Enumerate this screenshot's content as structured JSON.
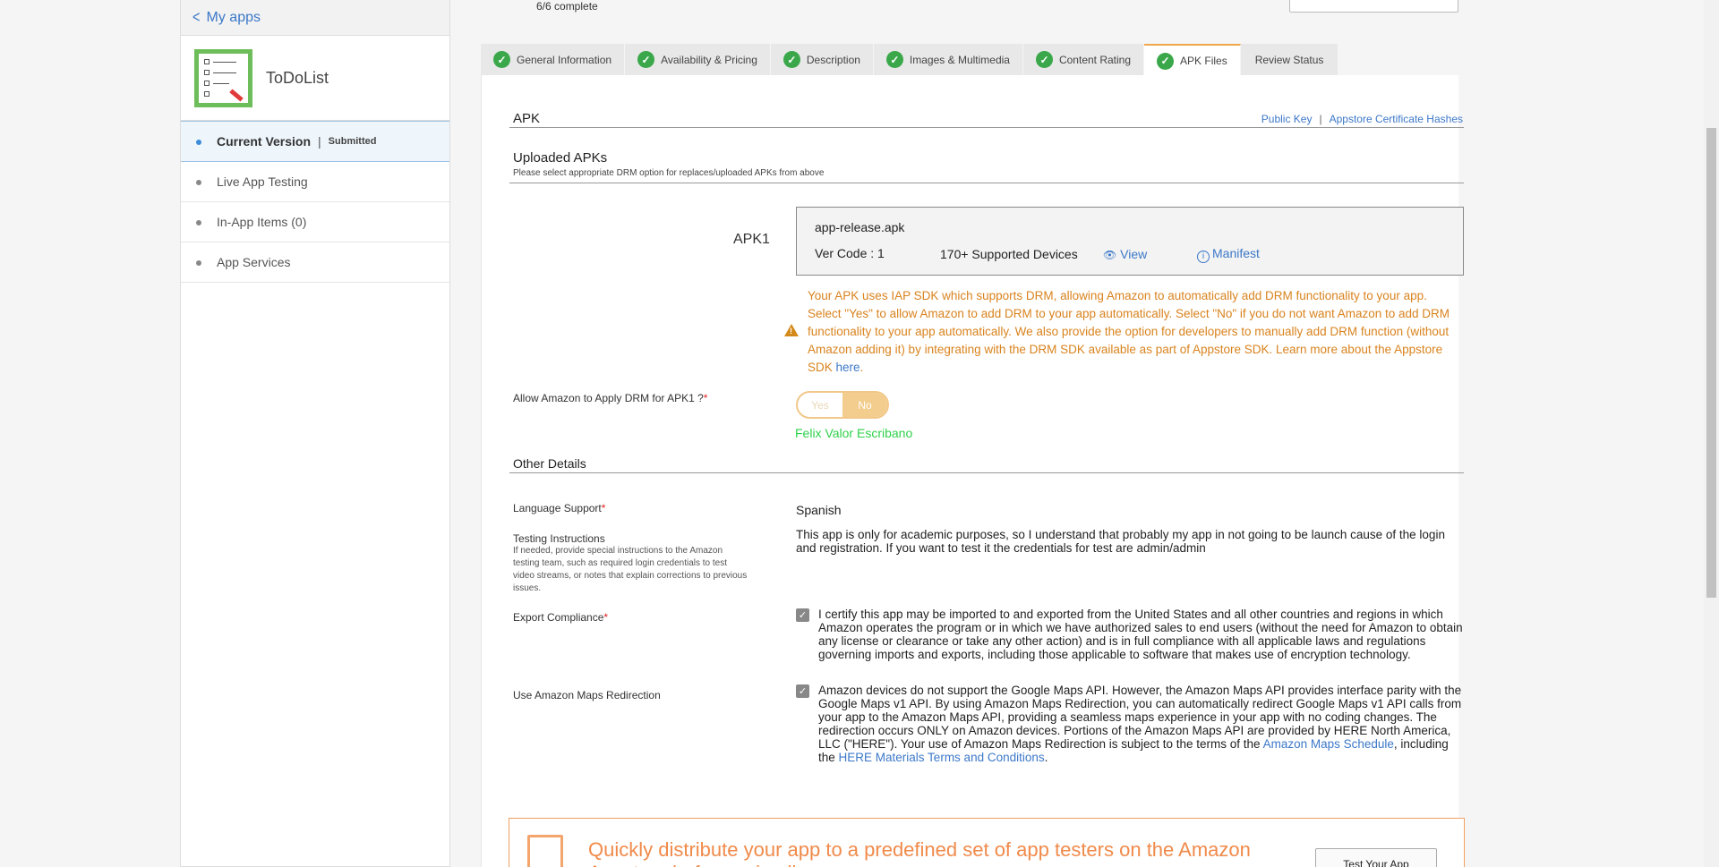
{
  "sidebar": {
    "back_label": "My apps",
    "app_name": "ToDoList",
    "items": [
      {
        "label": "Current Version",
        "status": "Submitted"
      },
      {
        "label": "Live App Testing"
      },
      {
        "label": "In-App Items (0)"
      },
      {
        "label": "App Services"
      }
    ]
  },
  "header": {
    "progress": "6/6 complete"
  },
  "tabs": [
    {
      "label": "General Information",
      "complete": true
    },
    {
      "label": "Availability & Pricing",
      "complete": true
    },
    {
      "label": "Description",
      "complete": true
    },
    {
      "label": "Images & Multimedia",
      "complete": true
    },
    {
      "label": "Content Rating",
      "complete": true
    },
    {
      "label": "APK Files",
      "complete": true,
      "active": true
    },
    {
      "label": "Review Status",
      "complete": false
    }
  ],
  "apk_section": {
    "title": "APK",
    "public_key_link": "Public Key",
    "link_separator": "|",
    "cert_hashes_link": "Appstore Certificate Hashes",
    "uploaded_title": "Uploaded APKs",
    "uploaded_note": "Please select appropriate DRM option for replaces/uploaded APKs from above",
    "apk_label": "APK1",
    "file_name": "app-release.apk",
    "ver_code": "Ver Code : 1",
    "devices": "170+ Supported Devices",
    "view_link": "View",
    "manifest_link": "Manifest",
    "warning_text": "Your APK uses IAP SDK which supports DRM, allowing Amazon to automatically add DRM functionality to your app. Select \"Yes\" to allow Amazon to add DRM to your app automatically. Select \"No\" if you do not want Amazon to add DRM functionality to your app automatically. We also provide the option for developers to manually add DRM function (without Amazon adding it) by integrating with the DRM SDK available as part of Appstore SDK. Learn more about the Appstore SDK ",
    "warning_link": "here",
    "warning_end": ".",
    "drm_label": "Allow Amazon to Apply DRM for APK1 ?",
    "drm_req": "*",
    "toggle_yes": "Yes",
    "toggle_no": "No",
    "toggle_selected": "No",
    "signature": "Felix Valor Escribano"
  },
  "other_details": {
    "title": "Other Details",
    "language_label": "Language Support",
    "language_req": "*",
    "language_value": "Spanish",
    "testing_label": "Testing Instructions",
    "testing_note": "If needed, provide special instructions to the Amazon testing team, such as required login credentials to test video streams, or notes that explain corrections to previous issues.",
    "testing_value": "This app is only for academic purposes, so I understand that probably my app in not going to be launch cause of the login and registration. If you want to test it the credentials for test are admin/admin",
    "export_label": "Export Compliance",
    "export_req": "*",
    "export_text": "I certify this app may be imported to and exported from the United States and all other countries and regions in which Amazon operates the program or in which we have authorized sales to end users (without the need for Amazon to obtain any license or clearance or take any other action) and is in full compliance with all applicable laws and regulations governing imports and exports, including those applicable to software that makes use of encryption technology.",
    "export_checked": true,
    "maps_label": "Use Amazon Maps Redirection",
    "maps_text": "Amazon devices do not support the Google Maps API. However, the Amazon Maps API provides interface parity with the Google Maps v1 API. By using Amazon Maps Redirection, you can automatically redirect Google Maps v1 API calls from your app to the Amazon Maps API, providing a seamless maps experience in your app with no coding changes. The redirection occurs ONLY on Amazon devices. Portions of the Amazon Maps API are provided by HERE North America, LLC (\"HERE\"). Your use of Amazon Maps Redirection is subject to the terms of the ",
    "maps_link1": "Amazon Maps Schedule",
    "maps_mid": ", including the ",
    "maps_link2": "HERE Materials Terms and Conditions",
    "maps_end": ".",
    "maps_checked": true
  },
  "promo": {
    "text": "Quickly distribute your app to a predefined set of app testers on the Amazon Appstore before going live",
    "button": "Test Your App"
  },
  "colors": {
    "accent": "#3c78c8",
    "check_green": "#3aa84a",
    "warning": "#d9831e",
    "active_tab_border": "#f0a64a",
    "signature": "#2ed14a"
  }
}
